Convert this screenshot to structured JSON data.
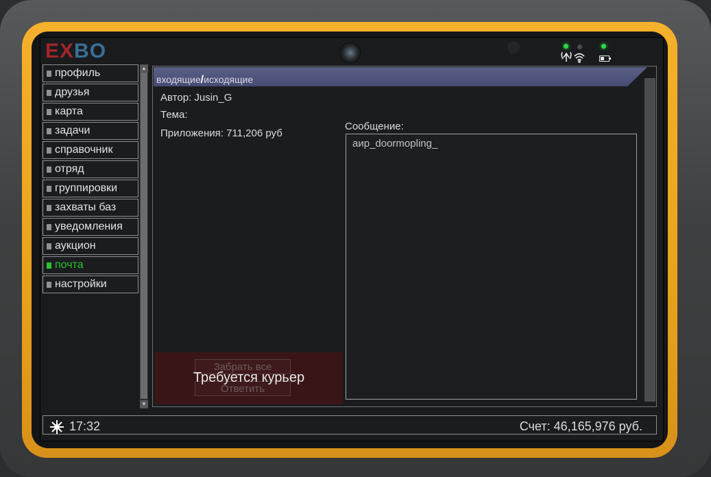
{
  "brand": {
    "logo_part1": "EX",
    "logo_part2": "BO"
  },
  "tabs": {
    "incoming": "входящие",
    "separator": "/",
    "outgoing": "исходящие"
  },
  "sidebar": {
    "items": [
      {
        "label": "профиль",
        "active": false
      },
      {
        "label": "друзья",
        "active": false
      },
      {
        "label": "карта",
        "active": false
      },
      {
        "label": "задачи",
        "active": false
      },
      {
        "label": "справочник",
        "active": false
      },
      {
        "label": "отряд",
        "active": false
      },
      {
        "label": "группировки",
        "active": false
      },
      {
        "label": "захваты баз",
        "active": false
      },
      {
        "label": "уведомления",
        "active": false
      },
      {
        "label": "аукцион",
        "active": false
      },
      {
        "label": "почта",
        "active": true
      },
      {
        "label": "настройки",
        "active": false
      }
    ]
  },
  "mail": {
    "author": "Автор: Jusin_G",
    "subject": "Тема:",
    "attachments": "Приложения: 711,206 руб",
    "message_label": "Сообщение:",
    "message_text": "аир_doormopling_",
    "take_all_button": "Забрать все",
    "reply_button": "Ответить",
    "courier_notice": "Требуется курьер"
  },
  "status": {
    "time": "17:32",
    "balance": "Счет: 46,165,976 руб."
  },
  "icons": {
    "wifi": "wifi-icon",
    "battery": "battery-icon",
    "sun": "sun-icon",
    "camera": "camera-icon"
  },
  "colors": {
    "frame": "#e9a21c",
    "active": "#28c52e",
    "tab_bar": "#4a4e76",
    "logo_red": "#a3262b",
    "logo_blue": "#3a6e96"
  }
}
